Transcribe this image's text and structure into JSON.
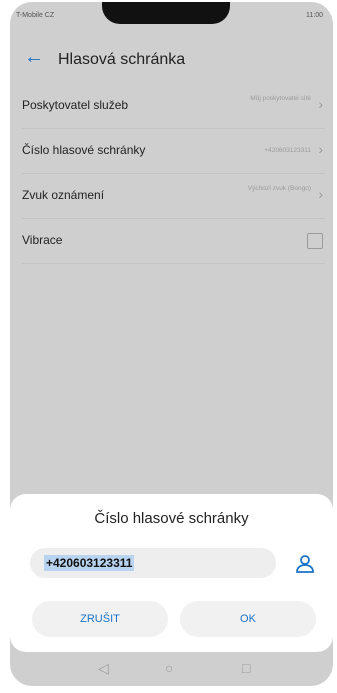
{
  "status": {
    "carrier": "T-Mobile CZ",
    "time": "11:00"
  },
  "header": {
    "title": "Hlasová schránka"
  },
  "settings": [
    {
      "label": "Poskytovatel služeb",
      "value": "Můj poskytovatel sítě",
      "control": "chevron"
    },
    {
      "label": "Číslo hlasové schránky",
      "value": "+420603123311",
      "control": "chevron"
    },
    {
      "label": "Zvuk oznámení",
      "value": "Výchozí zvuk (Bongo)",
      "control": "chevron"
    },
    {
      "label": "Vibrace",
      "value": "",
      "control": "checkbox"
    }
  ],
  "dialog": {
    "title": "Číslo hlasové schránky",
    "input_value": "+420603123311",
    "cancel_label": "ZRUŠIT",
    "ok_label": "OK"
  },
  "colors": {
    "accent": "#1a73c9",
    "overlay": "#cfcfcf"
  },
  "icons": {
    "back": "back-arrow-icon",
    "chevron": "chevron-right-icon",
    "contact": "contact-icon",
    "nav_back": "nav-back-icon",
    "nav_home": "nav-home-icon",
    "nav_recent": "nav-recent-icon"
  }
}
